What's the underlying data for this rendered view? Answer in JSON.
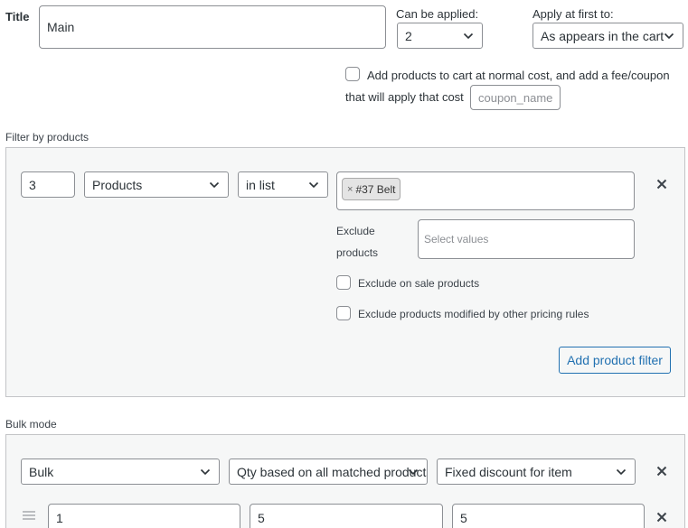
{
  "title_row": {
    "title_label": "Title",
    "title_value": "Main",
    "can_be_applied_label": "Can be applied:",
    "can_be_applied_value": "2",
    "apply_first_label": "Apply at first to:",
    "apply_first_value": "As appears in the cart"
  },
  "fee_option": {
    "line1": "Add products to cart at normal cost, and add a fee/coupon",
    "line2": "that will apply that cost",
    "coupon_placeholder": "coupon_name"
  },
  "product_filter": {
    "section_label": "Filter by products",
    "qty_value": "3",
    "type_value": "Products",
    "method_value": "in list",
    "selected_tag": "#37 Belt",
    "tag_remove_glyph": "×",
    "exclude_label_line1": "Exclude",
    "exclude_label_line2": "products",
    "exclude_placeholder": "Select values",
    "exclude_on_sale_label": "Exclude on sale products",
    "exclude_modified_label": "Exclude products modified by other pricing rules",
    "add_filter_label": "Add product filter"
  },
  "bulk": {
    "section_label": "Bulk mode",
    "mode_value": "Bulk",
    "qty_basis_value": "Qty based on all matched products",
    "discount_type_value": "Fixed discount for item",
    "range_row": {
      "from": "1",
      "to": "5",
      "value": "5"
    }
  },
  "icons": {
    "close": "close-icon",
    "chevron": "chevron-down-icon",
    "drag": "drag-handle-icon"
  },
  "colors": {
    "accent": "#2271b1",
    "border": "#8c8f94",
    "panel_bg": "#f6f7f7"
  }
}
